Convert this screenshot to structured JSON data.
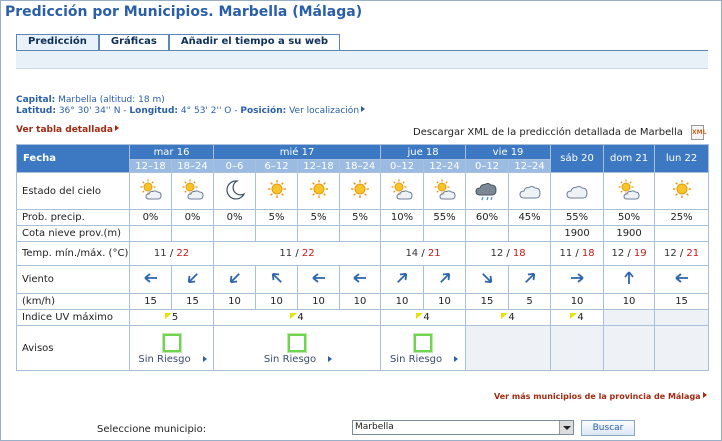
{
  "title": "Predicción por Municipios. Marbella (Málaga)",
  "tabs": [
    "Predicción",
    "Gráficas",
    "Añadir el tiempo a su web"
  ],
  "info": {
    "capital_label": "Capital:",
    "capital_value": "Marbella (altitud: 18 m)",
    "lat_label": "Latitud:",
    "lat_value": "36° 30' 34'' N -",
    "lon_label": "Longitud:",
    "lon_value": "4° 53' 2'' O -",
    "pos_label": "Posición:",
    "pos_link": "Ver localización"
  },
  "tabla_detallada": "Ver tabla detallada",
  "xml_text": "Descargar XML de la predicción detallada de Marbella",
  "table": {
    "fecha": "Fecha",
    "days": [
      {
        "label": "mar 16",
        "periods": [
          "12–18",
          "18–24"
        ]
      },
      {
        "label": "mié 17",
        "periods": [
          "0–6",
          "6–12",
          "12–18",
          "18–24"
        ]
      },
      {
        "label": "jue 18",
        "periods": [
          "0–12",
          "12–24"
        ]
      },
      {
        "label": "vie 19",
        "periods": [
          "0–12",
          "12–24"
        ]
      },
      {
        "label": "sáb 20",
        "periods": []
      },
      {
        "label": "dom 21",
        "periods": []
      },
      {
        "label": "lun 22",
        "periods": []
      }
    ],
    "row_labels": {
      "estado": "Estado del cielo",
      "prob": "Prob. precip.",
      "nieve": "Cota nieve prov.(m)",
      "temp": "Temp. mín./máx. (°C)",
      "viento": "Viento",
      "kmh": "(km/h)",
      "uv": "Indice UV máximo",
      "avisos": "Avisos"
    },
    "sky_icons": [
      "sun-cloud-icon",
      "sun-cloud-icon",
      "moon-icon",
      "sun-icon",
      "sun-icon",
      "sun-icon",
      "sun-cloud-icon",
      "sun-cloud-icon",
      "storm-cloud-icon",
      "cloud-icon",
      "cloud-icon",
      "sun-cloud-icon",
      "sun-icon"
    ],
    "prob": [
      "0%",
      "0%",
      "0%",
      "5%",
      "5%",
      "5%",
      "10%",
      "55%",
      "60%",
      "45%",
      "55%",
      "50%",
      "25%"
    ],
    "nieve": [
      "",
      "",
      "",
      "",
      "",
      "",
      "",
      "",
      "",
      "",
      "1900",
      "1900",
      ""
    ],
    "temps": [
      {
        "min": "11",
        "max": "22"
      },
      {
        "min": "11",
        "max": "22"
      },
      {
        "min": "14",
        "max": "21"
      },
      {
        "min": "12",
        "max": "18"
      },
      {
        "min": "11",
        "max": "18"
      },
      {
        "min": "12",
        "max": "19"
      },
      {
        "min": "12",
        "max": "21"
      }
    ],
    "wind_dirs": [
      "W",
      "SW",
      "SW",
      "NW",
      "W",
      "W",
      "NE",
      "NE",
      "SE",
      "NE",
      "E",
      "N",
      "W"
    ],
    "wind_speeds": [
      "15",
      "15",
      "10",
      "10",
      "10",
      "10",
      "10",
      "10",
      "15",
      "5",
      "10",
      "10",
      "15"
    ],
    "uv": [
      "5",
      "4",
      "4",
      "4",
      "4",
      "",
      "",
      ""
    ],
    "avisos_label": "Sin Riesgo"
  },
  "more_link": "Ver más municipios de la provincia de Málaga",
  "selector": {
    "label": "Seleccione municipio:",
    "value": "Marbella",
    "button": "Buscar"
  },
  "colors": {
    "header_blue": "#3d79c2",
    "period_blue": "#9bbbe2",
    "max_red": "#c41818",
    "aviso_green": "#6fd44f"
  }
}
